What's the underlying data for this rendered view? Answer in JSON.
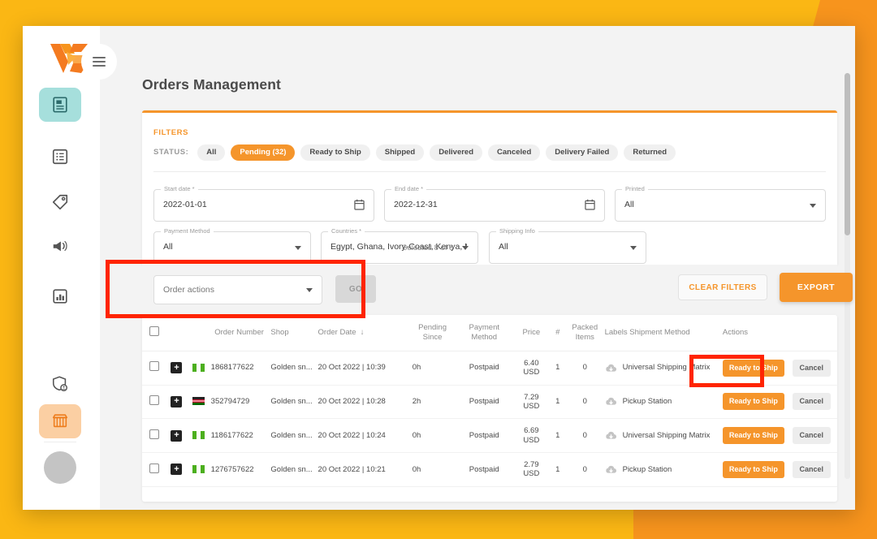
{
  "brand": {
    "logo_name": "vconnect-logo",
    "accent": "#F5952B",
    "highlight": "#FF2400"
  },
  "sidebar": {
    "items": [
      {
        "name": "orders",
        "icon": "orders-book-icon",
        "state": "active-teal"
      },
      {
        "name": "catalog",
        "icon": "list-icon",
        "state": "default"
      },
      {
        "name": "promotions",
        "icon": "tag-icon",
        "state": "default"
      },
      {
        "name": "marketing",
        "icon": "megaphone-icon",
        "state": "default"
      },
      {
        "name": "reports",
        "icon": "bar-chart-icon",
        "state": "default"
      },
      {
        "name": "account-health",
        "icon": "shield-user-icon",
        "state": "default"
      },
      {
        "name": "store",
        "icon": "storefront-icon",
        "state": "active-orange"
      }
    ],
    "avatar": "user-avatar",
    "menu_toggle": "hamburger-menu"
  },
  "header": {
    "title": "Orders Management"
  },
  "filters": {
    "label": "FILTERS",
    "status_label": "STATUS:",
    "status_chips": [
      {
        "label": "All",
        "selected": false
      },
      {
        "label": "Pending (32)",
        "selected": true
      },
      {
        "label": "Ready to Ship",
        "selected": false
      },
      {
        "label": "Shipped",
        "selected": false
      },
      {
        "label": "Delivered",
        "selected": false
      },
      {
        "label": "Canceled",
        "selected": false
      },
      {
        "label": "Delivery Failed",
        "selected": false
      },
      {
        "label": "Returned",
        "selected": false
      }
    ],
    "fields": [
      {
        "legend": "Start date *",
        "value": "2022-01-01",
        "control": "date"
      },
      {
        "legend": "End date *",
        "value": "2022-12-31",
        "control": "date"
      },
      {
        "legend": "Printed",
        "value": "All",
        "control": "select"
      },
      {
        "legend": "Payment Method",
        "value": "All",
        "control": "select"
      },
      {
        "legend": "Countries *",
        "value": "Egypt, Ghana, Ivory-Coast, Kenya, M...",
        "control": "select"
      },
      {
        "legend": "Shipping Info",
        "value": "All",
        "control": "select"
      }
    ],
    "selected_note": "Selected 8 of 8"
  },
  "actions_bar": {
    "order_actions_placeholder": "Order actions",
    "go_label": "GO",
    "clear_filters_label": "CLEAR FILTERS",
    "export_label": "EXPORT"
  },
  "table": {
    "headers": [
      "",
      "",
      "",
      "Order Number",
      "Shop",
      "Order Date",
      "Pending Since",
      "Payment Method",
      "Price",
      "#",
      "Packed Items",
      "Labels Shipment Method",
      "Actions"
    ],
    "sort_column": "Order Date",
    "sort_direction": "desc",
    "rows": [
      {
        "order_number": "1868177622",
        "shop": "Golden sn...",
        "order_date": "20 Oct 2022 | 10:39",
        "pending_since": "0h",
        "payment_method": "Postpaid",
        "price": "6.40",
        "currency": "USD",
        "count": "1",
        "packed_items": "0",
        "shipment_method": "Universal Shipping Matrix",
        "flag": "ng",
        "ready_label": "Ready to Ship",
        "cancel_label": "Cancel"
      },
      {
        "order_number": "352794729",
        "shop": "Golden sn...",
        "order_date": "20 Oct 2022 | 10:28",
        "pending_since": "2h",
        "payment_method": "Postpaid",
        "price": "7.29",
        "currency": "USD",
        "count": "1",
        "packed_items": "0",
        "shipment_method": "Pickup Station",
        "flag": "ke",
        "ready_label": "Ready to Ship",
        "cancel_label": "Cancel"
      },
      {
        "order_number": "1186177622",
        "shop": "Golden sn...",
        "order_date": "20 Oct 2022 | 10:24",
        "pending_since": "0h",
        "payment_method": "Postpaid",
        "price": "6.69",
        "currency": "USD",
        "count": "1",
        "packed_items": "0",
        "shipment_method": "Universal Shipping Matrix",
        "flag": "ng",
        "ready_label": "Ready to Ship",
        "cancel_label": "Cancel"
      },
      {
        "order_number": "1276757622",
        "shop": "Golden sn...",
        "order_date": "20 Oct 2022 | 10:21",
        "pending_since": "0h",
        "payment_method": "Postpaid",
        "price": "2.79",
        "currency": "USD",
        "count": "1",
        "packed_items": "0",
        "shipment_method": "Pickup Station",
        "flag": "ng",
        "ready_label": "Ready to Ship",
        "cancel_label": "Cancel"
      }
    ]
  }
}
